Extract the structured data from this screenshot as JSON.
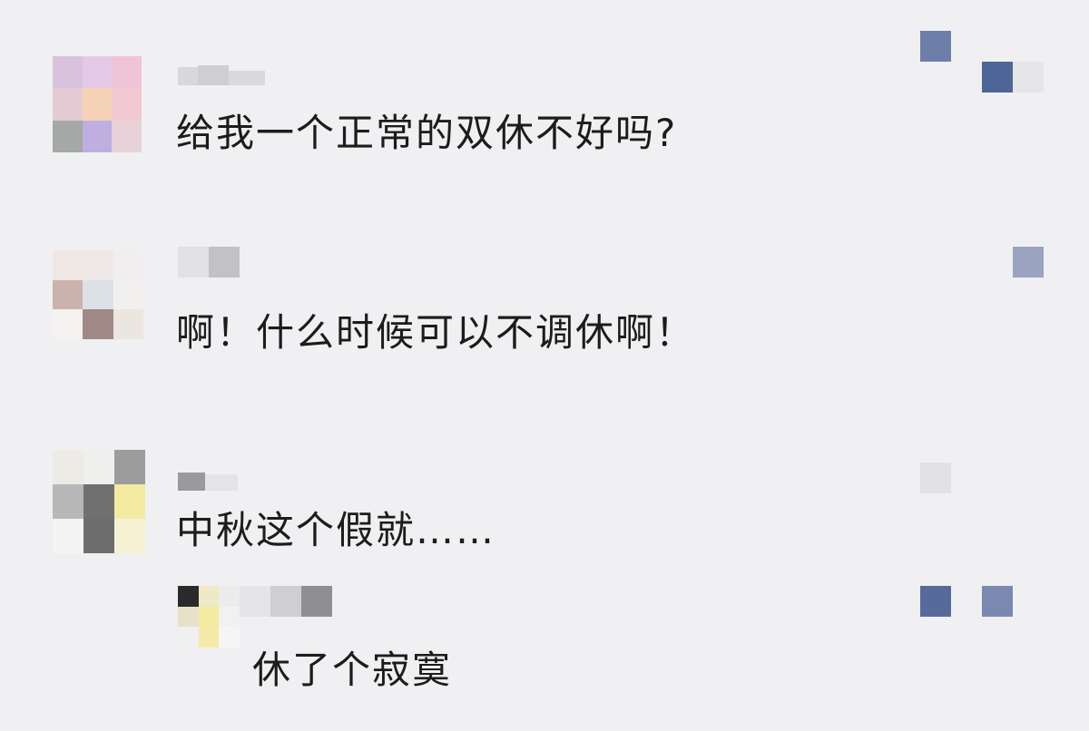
{
  "comments": [
    {
      "text": "给我一个正常的双休不好吗?"
    },
    {
      "text": "啊！什么时候可以不调休啊！"
    },
    {
      "text": "中秋这个假就……"
    }
  ],
  "reply": {
    "text": "休了个寂寞"
  },
  "colors": {
    "background": "#f0f0f2",
    "text": "#1c1c1c",
    "like_icon": "#566a9c",
    "like_icon_light": "#9aa4c0"
  },
  "icons": [
    "like-icon"
  ]
}
